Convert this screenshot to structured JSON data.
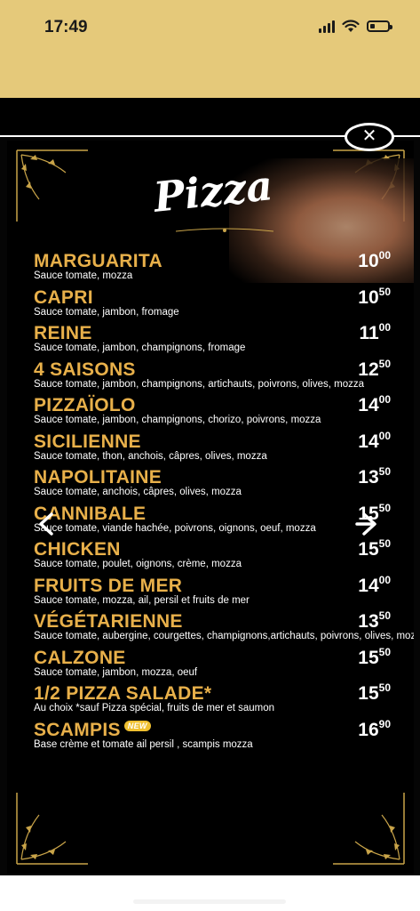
{
  "status": {
    "time": "17:49",
    "battery_level": 0.3
  },
  "viewer": {
    "close_symbol": "✕"
  },
  "menu": {
    "title": "Pizza",
    "items": [
      {
        "name": "MARGUARITA",
        "desc": "Sauce tomate, mozza",
        "price_main": "10",
        "price_cents": "00"
      },
      {
        "name": "CAPRI",
        "desc": "Sauce tomate, jambon, fromage",
        "price_main": "10",
        "price_cents": "50"
      },
      {
        "name": "REINE",
        "desc": "Sauce tomate, jambon, champignons, fromage",
        "price_main": "11",
        "price_cents": "00"
      },
      {
        "name": "4 SAISONS",
        "desc": "Sauce tomate, jambon, champignons, artichauts, poivrons, olives, mozza",
        "price_main": "12",
        "price_cents": "50"
      },
      {
        "name": "PIZZAÏOLO",
        "desc": "Sauce tomate, jambon, champignons, chorizo, poivrons, mozza",
        "price_main": "14",
        "price_cents": "00"
      },
      {
        "name": "SICILIENNE",
        "desc": "Sauce tomate, thon, anchois, câpres, olives, mozza",
        "price_main": "14",
        "price_cents": "00"
      },
      {
        "name": "NAPOLITAINE",
        "desc": "Sauce tomate,  anchois, câpres, olives, mozza",
        "price_main": "13",
        "price_cents": "50"
      },
      {
        "name": "CANNIBALE",
        "desc": "Sauce tomate, viande hachée, poivrons, oignons, oeuf, mozza",
        "price_main": "15",
        "price_cents": "50"
      },
      {
        "name": "CHICKEN",
        "desc": "Sauce tomate, poulet, oignons, crème, mozza",
        "price_main": "15",
        "price_cents": "50"
      },
      {
        "name": "FRUITS DE MER",
        "desc": "Sauce tomate, mozza, ail, persil et fruits de mer",
        "price_main": "14",
        "price_cents": "00"
      },
      {
        "name": "VÉGÉTARIENNE",
        "desc": "Sauce tomate, aubergine, courgettes, champignons,artichauts, poivrons, olives, mozza",
        "price_main": "13",
        "price_cents": "50"
      },
      {
        "name": "CALZONE",
        "desc": "Sauce tomate, jambon, mozza, oeuf",
        "price_main": "15",
        "price_cents": "50"
      },
      {
        "name": "1/2 PIZZA SALADE*",
        "desc": "Au choix *sauf Pizza spécial, fruits de mer et saumon",
        "price_main": "15",
        "price_cents": "50"
      },
      {
        "name": "SCAMPIS",
        "desc": "Base crème et tomate ail persil , scampis mozza",
        "price_main": "16",
        "price_cents": "90",
        "badge": "NEW"
      }
    ]
  },
  "colors": {
    "gold": "#e8b04a",
    "status_bg": "#e5c97a",
    "badge": "#f0c030"
  },
  "icons": {
    "prev": "chevron-left-icon",
    "next": "chevron-right-icon",
    "close": "close-icon"
  }
}
